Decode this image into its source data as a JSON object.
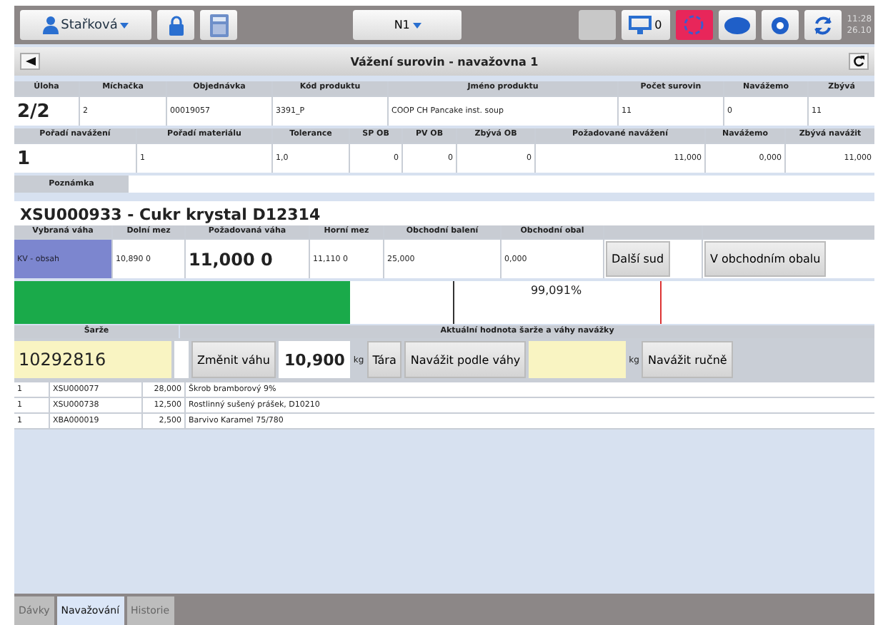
{
  "top_bar": {
    "user": "Stařková",
    "line": "N1",
    "monitor_count": "0",
    "time": "11:28",
    "date": "26.10"
  },
  "window": {
    "title": "Vážení surovin - navažovna 1"
  },
  "order_table": {
    "columns": [
      "Úloha",
      "Míchačka",
      "Objednávka",
      "Kód produktu",
      "Jméno produktu",
      "Počet surovin",
      "Navážemo",
      "Zbývá"
    ],
    "row": [
      "2/2",
      "2",
      "00019057",
      "3391_P",
      "COOP CH Pancake inst. soup",
      "11",
      "0",
      "11"
    ]
  },
  "material_table": {
    "columns": [
      "Pořadí navážení",
      "Pořadí materiálu",
      "Tolerance",
      "SP OB",
      "PV OB",
      "Zbývá OB",
      "Požadované navážení",
      "Navážemo",
      "Zbývá navážit"
    ],
    "row": [
      "1",
      "1",
      "1,0",
      "0",
      "0",
      "0",
      "11,000",
      "0,000",
      "11,000"
    ]
  },
  "note": {
    "label": "Poznámka"
  },
  "material_title": "XSU000933 - Cukr krystal D12314",
  "weight_table": {
    "columns": [
      "Vybraná váha",
      "Dolní mez",
      "Požadovaná váha",
      "Horní mez",
      "Obchodní balení",
      "Obchodní obal"
    ],
    "row": [
      "KV - obsah",
      "10,890 0",
      "11,000 0",
      "11,110 0",
      "25,000",
      "0,000"
    ],
    "buttons": [
      "Další sud",
      "V obchodním obalu"
    ]
  },
  "progress": {
    "level": 0.39,
    "reading": "99,091%"
  },
  "batch": {
    "label": "Šarže",
    "value": "10292816",
    "current_label": "Aktuální hodnota šarže a váhy navážky",
    "change_button": "Změnit váhu",
    "weight": "10,900",
    "unit": "kg",
    "tare_button": "Tára",
    "weigh_button": "Navážit podle váhy",
    "manual_unit": "kg",
    "manual_button": "Navážit ručně"
  },
  "weighed_items": [
    [
      "1",
      "XSU000077",
      "28,000",
      "Škrob bramborový 9%"
    ],
    [
      "1",
      "XSU000738",
      "12,500",
      "Rostlinný sušený prášek, D10210"
    ],
    [
      "1",
      "XBA000019",
      "2,500",
      "Barvivo Karamel 75/780"
    ]
  ],
  "tabs": [
    {
      "label": "Dávky",
      "selected": false
    },
    {
      "label": "Navažování",
      "selected": true
    },
    {
      "label": "Historie",
      "selected": false
    }
  ]
}
